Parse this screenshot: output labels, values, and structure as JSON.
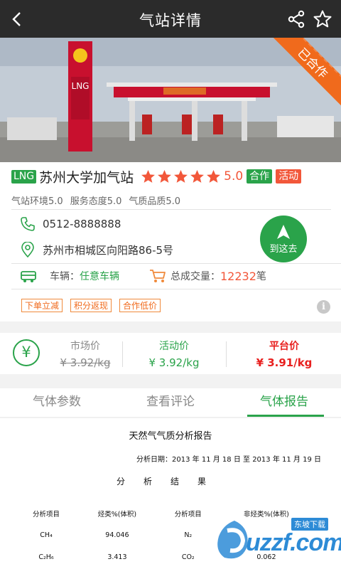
{
  "header": {
    "title": "气站详情"
  },
  "hero": {
    "ribbon": "已合作",
    "sign_top": "LNG",
    "sign_chars": "加气站"
  },
  "station": {
    "badge": "LNG",
    "name": "苏州大学加气站",
    "rating": "5.0",
    "stars": 5,
    "tags": {
      "cooperate": "合作",
      "activity": "活动"
    }
  },
  "scores": {
    "environment": "气站环境5.0",
    "service": "服务态度5.0",
    "quality": "气质品质5.0"
  },
  "contact": {
    "phone": "0512-8888888",
    "address": "苏州市相城区向阳路86-5号",
    "navigate_label": "到这去"
  },
  "info": {
    "vehicle_label": "车辆：",
    "vehicle_value": "任意车辆",
    "volume_label": "总成交量：",
    "volume_value": "12232",
    "volume_unit": "笔"
  },
  "promos": [
    "下单立减",
    "积分返现",
    "合作低价"
  ],
  "prices": {
    "market": {
      "label": "市场价",
      "value": "¥ 3.92/kg"
    },
    "activity": {
      "label": "活动价",
      "value": "¥ 3.92/kg"
    },
    "platform": {
      "label": "平台价",
      "value": "¥ 3.91/kg"
    }
  },
  "tabs": [
    "气体参数",
    "查看评论",
    "气体报告"
  ],
  "report": {
    "title": "天然气气质分析报告",
    "date": "分析日期：2013 年 11 月 18 日 至 2013 年 11 月 19 日",
    "heading": "分析结果",
    "columns": [
      "分析项目",
      "烃类%(体积)",
      "分析项目",
      "非烃类%(体积)"
    ],
    "rows": [
      [
        "CH₄",
        "94.046",
        "N₂",
        ""
      ],
      [
        "C₂H₆",
        "3.413",
        "CO₂",
        "0.062"
      ]
    ]
  },
  "watermark": {
    "badge": "东坡下载",
    "text": "uzzf.com"
  },
  "colors": {
    "green": "#2aa34a",
    "orange": "#f2573a",
    "topbar": "#2b2b2b"
  }
}
